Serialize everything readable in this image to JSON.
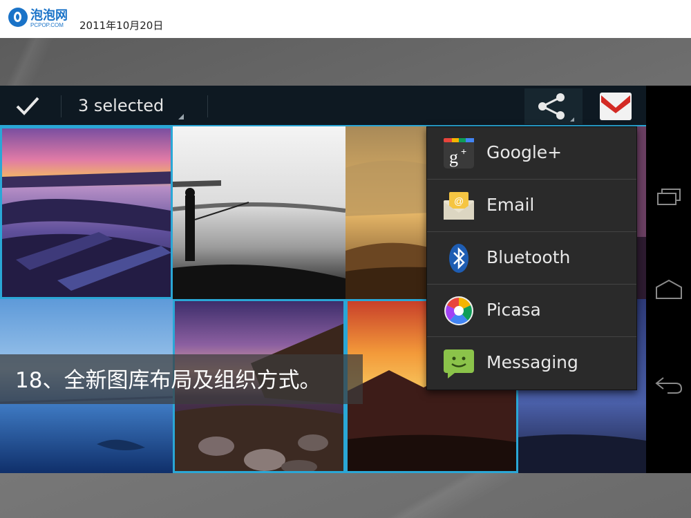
{
  "header": {
    "logo_name": "泡泡网",
    "logo_sub": "PCPOP.COM",
    "date": "2011年10月20日"
  },
  "actionbar": {
    "selected_label": "3 selected",
    "icons": [
      "check-icon",
      "share-icon",
      "gmail-icon"
    ],
    "accent_color": "#2aa7d6"
  },
  "share_menu": {
    "items": [
      {
        "label": "Google+",
        "icon": "google-plus-icon"
      },
      {
        "label": "Email",
        "icon": "email-icon"
      },
      {
        "label": "Bluetooth",
        "icon": "bluetooth-icon"
      },
      {
        "label": "Picasa",
        "icon": "picasa-icon"
      },
      {
        "label": "Messaging",
        "icon": "messaging-icon"
      }
    ]
  },
  "gallery": {
    "photos": [
      {
        "selected": true
      },
      {
        "selected": false
      },
      {
        "selected": false
      },
      {
        "selected": false
      },
      {
        "selected": true
      },
      {
        "selected": true
      },
      {
        "selected": false
      }
    ]
  },
  "navbar": {
    "icons": [
      "recent-apps-icon",
      "home-icon",
      "back-icon"
    ]
  },
  "caption": "18、全新图库布局及组织方式。"
}
